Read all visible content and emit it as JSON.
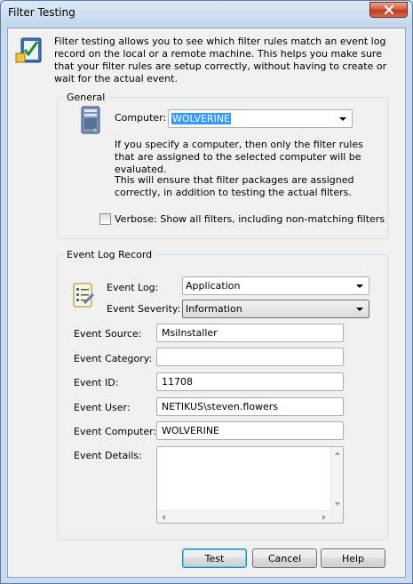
{
  "window": {
    "title": "Filter Testing"
  },
  "intro": {
    "text": "Filter testing allows you to see which filter rules match an event log record on the local or a remote machine. This helps you make sure that your filter rules are setup correctly, without having to create or wait for the actual event."
  },
  "general": {
    "legend": "General",
    "computer_label": "Computer:",
    "computer_value": "WOLVERINE",
    "note1": "If you specify a computer, then only the filter rules that are assigned to the selected computer will be evaluated.",
    "note2": "This will ensure that filter packages are assigned correctly, in addition to testing the actual filters.",
    "verbose_label": "Verbose: Show all filters, including non-matching filters",
    "verbose_checked": false
  },
  "record": {
    "legend": "Event Log Record",
    "event_log_label": "Event Log:",
    "event_log_value": "Application",
    "severity_label": "Event Severity:",
    "severity_value": "Information",
    "source_label": "Event Source:",
    "source_value": "MsiInstaller",
    "category_label": "Event Category:",
    "category_value": "",
    "id_label": "Event ID:",
    "id_value": "11708",
    "user_label": "Event User:",
    "user_value": "NETIKUS\\steven.flowers",
    "computer_label": "Event Computer:",
    "computer_value": "WOLVERINE",
    "details_label": "Event Details:",
    "details_value": ""
  },
  "buttons": {
    "test": "Test",
    "cancel": "Cancel",
    "help": "Help"
  }
}
